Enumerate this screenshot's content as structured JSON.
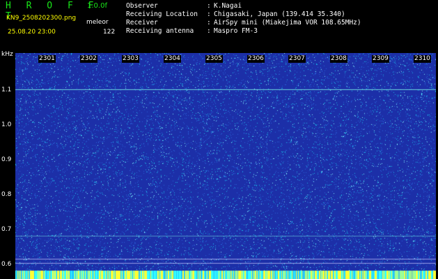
{
  "header": {
    "brand": "H R O F F T",
    "version": "1.0.0f",
    "file_name": "KN9_2508202300.png",
    "mode": "meleor",
    "datetime": "25.08.20 23:00",
    "count": "122"
  },
  "info": [
    {
      "label": "Observer",
      "value": "K.Nagai"
    },
    {
      "label": "Receiving Location",
      "value": "Chigasaki, Japan (139.414 35.340)"
    },
    {
      "label": "Receiver",
      "value": "AirSpy mini (Miakejima VOR 108.65MHz)"
    },
    {
      "label": "Receiving antenna",
      "value": "Maspro FM-3"
    }
  ],
  "separator": ":",
  "axis": {
    "y_unit": "kHz",
    "y_ticks": [
      "1.1",
      "1.0",
      "0.9",
      "0.8",
      "0.7",
      "0.6"
    ],
    "x_ticks": [
      "2301",
      "2302",
      "2303",
      "2304",
      "2305",
      "2306",
      "2307",
      "2308",
      "2309",
      "2310"
    ]
  },
  "colors": {
    "background": "#000000",
    "waterfall_base": "#1c2fa8",
    "noise": "#00e5ff",
    "brand": "#19e619",
    "highlight": "#ffff00"
  }
}
